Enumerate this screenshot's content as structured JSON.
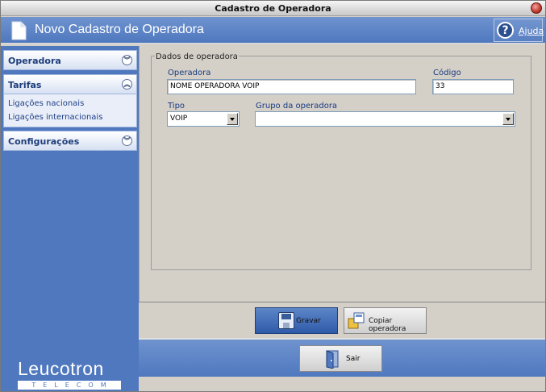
{
  "window": {
    "title": "Cadastro de Operadora"
  },
  "header": {
    "title": "Novo Cadastro de Operadora",
    "help_label": "Ajuda"
  },
  "sidebar": {
    "groups": [
      {
        "label": "Operadora",
        "expanded": false,
        "items": []
      },
      {
        "label": "Tarifas",
        "expanded": true,
        "items": [
          {
            "label": "Ligações nacionais"
          },
          {
            "label": "Ligações internacionais"
          }
        ]
      },
      {
        "label": "Configurações",
        "expanded": false,
        "items": []
      }
    ],
    "logo": {
      "brand": "Leucotron",
      "sub": "TELECOM"
    }
  },
  "form": {
    "group_label": "Dados de operadora",
    "operadora": {
      "label": "Operadora",
      "value": "NOME OPERADORA VOIP"
    },
    "codigo": {
      "label": "Código",
      "value": "33"
    },
    "tipo": {
      "label": "Tipo",
      "value": "VOIP"
    },
    "grupo": {
      "label": "Grupo da operadora",
      "value": ""
    }
  },
  "buttons": {
    "gravar": "Gravar",
    "copiar": "Copiar operadora",
    "sair": "Sair"
  },
  "colors": {
    "accent": "#4f78be",
    "header": "#6f93cf",
    "panel": "#d4d0c8"
  }
}
